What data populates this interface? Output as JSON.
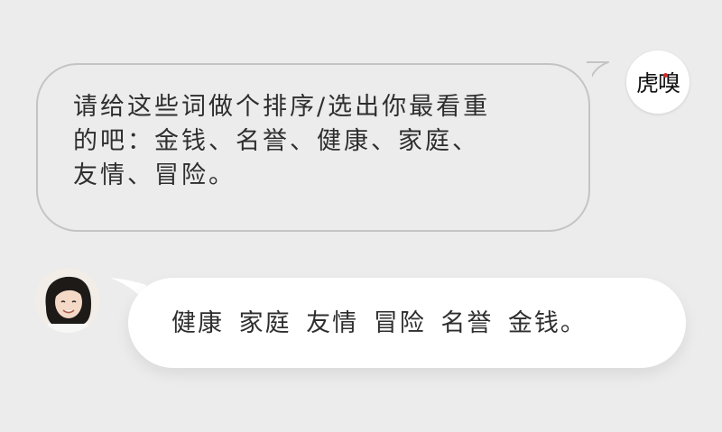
{
  "conversation": {
    "question": {
      "sender": "虎嗅",
      "text": "请给这些词做个排序/选出你最看重\n的吧：金钱、名誉、健康、家庭、\n友情、冒险。"
    },
    "answer": {
      "text": "健康 家庭 友情 冒险 名誉 金钱。"
    }
  },
  "colors": {
    "background": "#ececec",
    "question_bubble_border": "#c4c4c4",
    "answer_bubble": "#ffffff",
    "logo_accent": "#d12b2b"
  },
  "icons": {
    "sender_avatar": "huxiu-logo-avatar",
    "user_avatar": "woman-portrait-avatar"
  }
}
